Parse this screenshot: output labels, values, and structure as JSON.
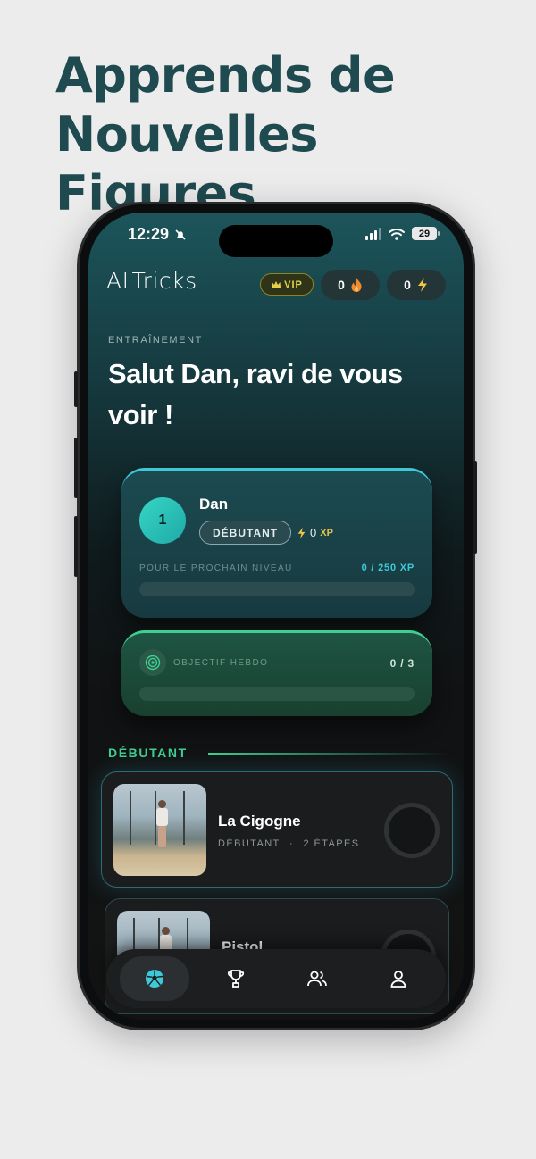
{
  "headline": {
    "line1": "Apprends de",
    "line2": "Nouvelles Figures"
  },
  "status_bar": {
    "time": "12:29",
    "battery": "29"
  },
  "header": {
    "logo": "ALTricks",
    "vip_label": "VIP",
    "streak_count": "0",
    "energy_count": "0"
  },
  "main": {
    "eyebrow": "ENTRAÎNEMENT",
    "greeting": "Salut Dan, ravi de vous voir !"
  },
  "level_card": {
    "level": "1",
    "user_name": "Dan",
    "level_name": "DÉBUTANT",
    "xp_value": "0",
    "xp_unit": "XP",
    "next_level_label": "POUR LE PROCHAIN NIVEAU",
    "next_level_value": "0 / 250 XP",
    "progress": 0
  },
  "weekly_goal": {
    "label": "OBJECTIF HEBDO",
    "value": "0 / 3",
    "progress": 0
  },
  "section": {
    "title": "DÉBUTANT"
  },
  "tricks": [
    {
      "name": "La Cigogne",
      "level": "DÉBUTANT",
      "separator": "·",
      "steps": "2 ÉTAPES"
    },
    {
      "name": "Pistol"
    }
  ],
  "tabbar": {
    "items": [
      {
        "icon": "soccer-ball-icon"
      },
      {
        "icon": "trophy-icon"
      },
      {
        "icon": "users-icon"
      },
      {
        "icon": "profile-icon"
      }
    ]
  },
  "colors": {
    "accent_cyan": "#3ec8d8",
    "accent_green": "#3fcf93",
    "vip_gold": "#e6d24a",
    "headline": "#1f4a4f"
  }
}
